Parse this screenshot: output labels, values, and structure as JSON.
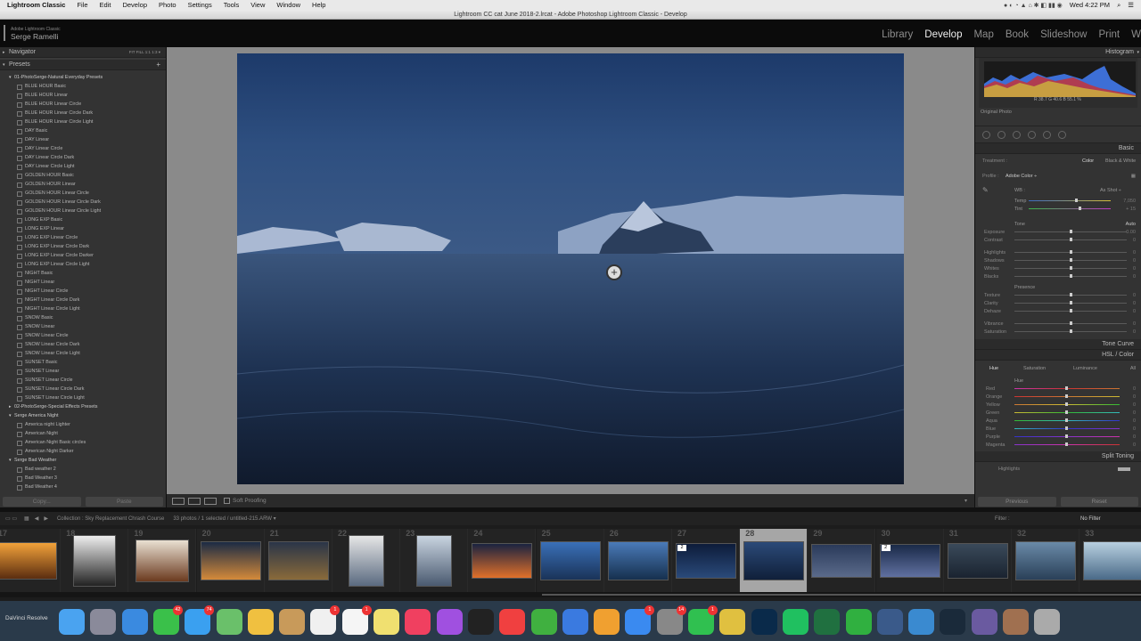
{
  "menubar": {
    "app": "Lightroom Classic",
    "items": [
      "File",
      "Edit",
      "Develop",
      "Photo",
      "Settings",
      "Tools",
      "View",
      "Window",
      "Help"
    ],
    "clock": "Wed 4:22 PM"
  },
  "window_title": "Lightroom CC cat June 2018-2.lrcat - Adobe Photoshop Lightroom Classic - Develop",
  "identity": {
    "product": "Adobe Lightroom Classic",
    "user": "Serge Ramelli"
  },
  "modules": {
    "items": [
      "Library",
      "Develop",
      "Map",
      "Book",
      "Slideshow",
      "Print",
      "W"
    ],
    "active": "Develop"
  },
  "navigator": {
    "title": "Navigator",
    "options": "FIT   FILL   1:1   1:3  ▾"
  },
  "presets": {
    "title": "Presets",
    "groups": [
      {
        "name": "01-PhotoSerge-Natural Everyday Presets",
        "open": true,
        "items": [
          "BLUE HOUR Basic",
          "BLUE HOUR Linear",
          "BLUE HOUR Linear Circle",
          "BLUE HOUR Linear Circle Dark",
          "BLUE HOUR Linear Circle Light",
          "DAY Basic",
          "DAY Linear",
          "DAY Linear Circle",
          "DAY Linear Circle Dark",
          "DAY Linear Circle Light",
          "GOLDEN HOUR Basic",
          "GOLDEN HOUR Linear",
          "GOLDEN HOUR Linear Circle",
          "GOLDEN HOUR Linear Circle Dark",
          "GOLDEN HOUR Linear Circle Light",
          "LONG EXP Basic",
          "LONG EXP Linear",
          "LONG EXP Linear Circle",
          "LONG EXP Linear Circle Dark",
          "LONG EXP Linear Circle Darker",
          "LONG EXP Linear Circle Light",
          "NIGHT Basic",
          "NIGHT Linear",
          "NIGHT Linear Circle",
          "NIGHT Linear Circle Dark",
          "NIGHT Linear Circle Light",
          "SNOW Basic",
          "SNOW Linear",
          "SNOW Linear Circle",
          "SNOW Linear Circle Dark",
          "SNOW Linear Circle Light",
          "SUNSET Basic",
          "SUNSET Linear",
          "SUNSET Linear Circle",
          "SUNSET Linear Circle Dark",
          "SUNSET Linear Circle Light"
        ]
      },
      {
        "name": "02-PhotoSerge-Special Effects Presets",
        "open": false,
        "items": []
      },
      {
        "name": "Serge America Night",
        "open": true,
        "items": [
          "America night Lighter",
          "American Night",
          "American Night Basic circles",
          "American Night Darker"
        ]
      },
      {
        "name": "Serge Bad Weather",
        "open": true,
        "items": [
          "Bad weather 2",
          "Bad Weather 3",
          "Bad Weather 4"
        ]
      }
    ]
  },
  "left_buttons": {
    "copy": "Copy...",
    "paste": "Paste"
  },
  "toolbar": {
    "soft_proofing": "Soft Proofing"
  },
  "right": {
    "histogram": "Histogram",
    "rgb": "R  38.7  G  40.6  B  55.1  %",
    "original_photo": "Original Photo",
    "basic": "Basic",
    "treatment": "Treatment :",
    "color": "Color",
    "bw": "Black & White",
    "profile_label": "Profile :",
    "profile": "Adobe Color ÷",
    "wb": "WB :",
    "wb_value": "As Shot ÷",
    "temp": {
      "label": "Temp",
      "value": "7,050"
    },
    "tint": {
      "label": "Tint",
      "value": "+ 15"
    },
    "tone": "Tone",
    "auto": "Auto",
    "tone_rows": [
      {
        "label": "Exposure",
        "value": "0.00"
      },
      {
        "label": "Contrast",
        "value": "0"
      },
      {
        "label": "Highlights",
        "value": "0"
      },
      {
        "label": "Shadows",
        "value": "0"
      },
      {
        "label": "Whites",
        "value": "0"
      },
      {
        "label": "Blacks",
        "value": "0"
      }
    ],
    "presence": "Presence",
    "presence_rows": [
      {
        "label": "Texture",
        "value": "0"
      },
      {
        "label": "Clarity",
        "value": "0"
      },
      {
        "label": "Dehaze",
        "value": "0"
      },
      {
        "label": "Vibrance",
        "value": "0"
      },
      {
        "label": "Saturation",
        "value": "0"
      }
    ],
    "tone_curve": "Tone Curve",
    "hsl": "HSL / Color",
    "hsl_tabs": [
      "Hue",
      "Saturation",
      "Luminance",
      "All"
    ],
    "hue_title": "Hue",
    "hue_rows": [
      "Red",
      "Orange",
      "Yellow",
      "Green",
      "Aqua",
      "Blue",
      "Purple",
      "Magenta"
    ],
    "hue_values": [
      "0",
      "0",
      "0",
      "0",
      "0",
      "0",
      "0",
      "0"
    ],
    "split_toning": "Split Toning",
    "highlights": "Highlights",
    "previous": "Previous",
    "reset": "Reset"
  },
  "stripbar": {
    "collection": "Collection : Sky Replacement Chrash Course",
    "count": "33 photos / 1 selected / untitled-215.ARW ▾",
    "filter": "Filter :",
    "no_filter": "No Filter"
  },
  "filmstrip": {
    "numbers": [
      "17",
      "18",
      "19",
      "20",
      "21",
      "22",
      "23",
      "24",
      "25",
      "26",
      "27",
      "28",
      "29",
      "30",
      "31",
      "32",
      "33"
    ],
    "selected": "28",
    "badges": [
      "2",
      "2"
    ]
  },
  "dock": {
    "left_label": "DaVinci Resolve",
    "badges": [
      "42",
      "74",
      "1",
      "1",
      "14",
      "1",
      "1"
    ]
  }
}
